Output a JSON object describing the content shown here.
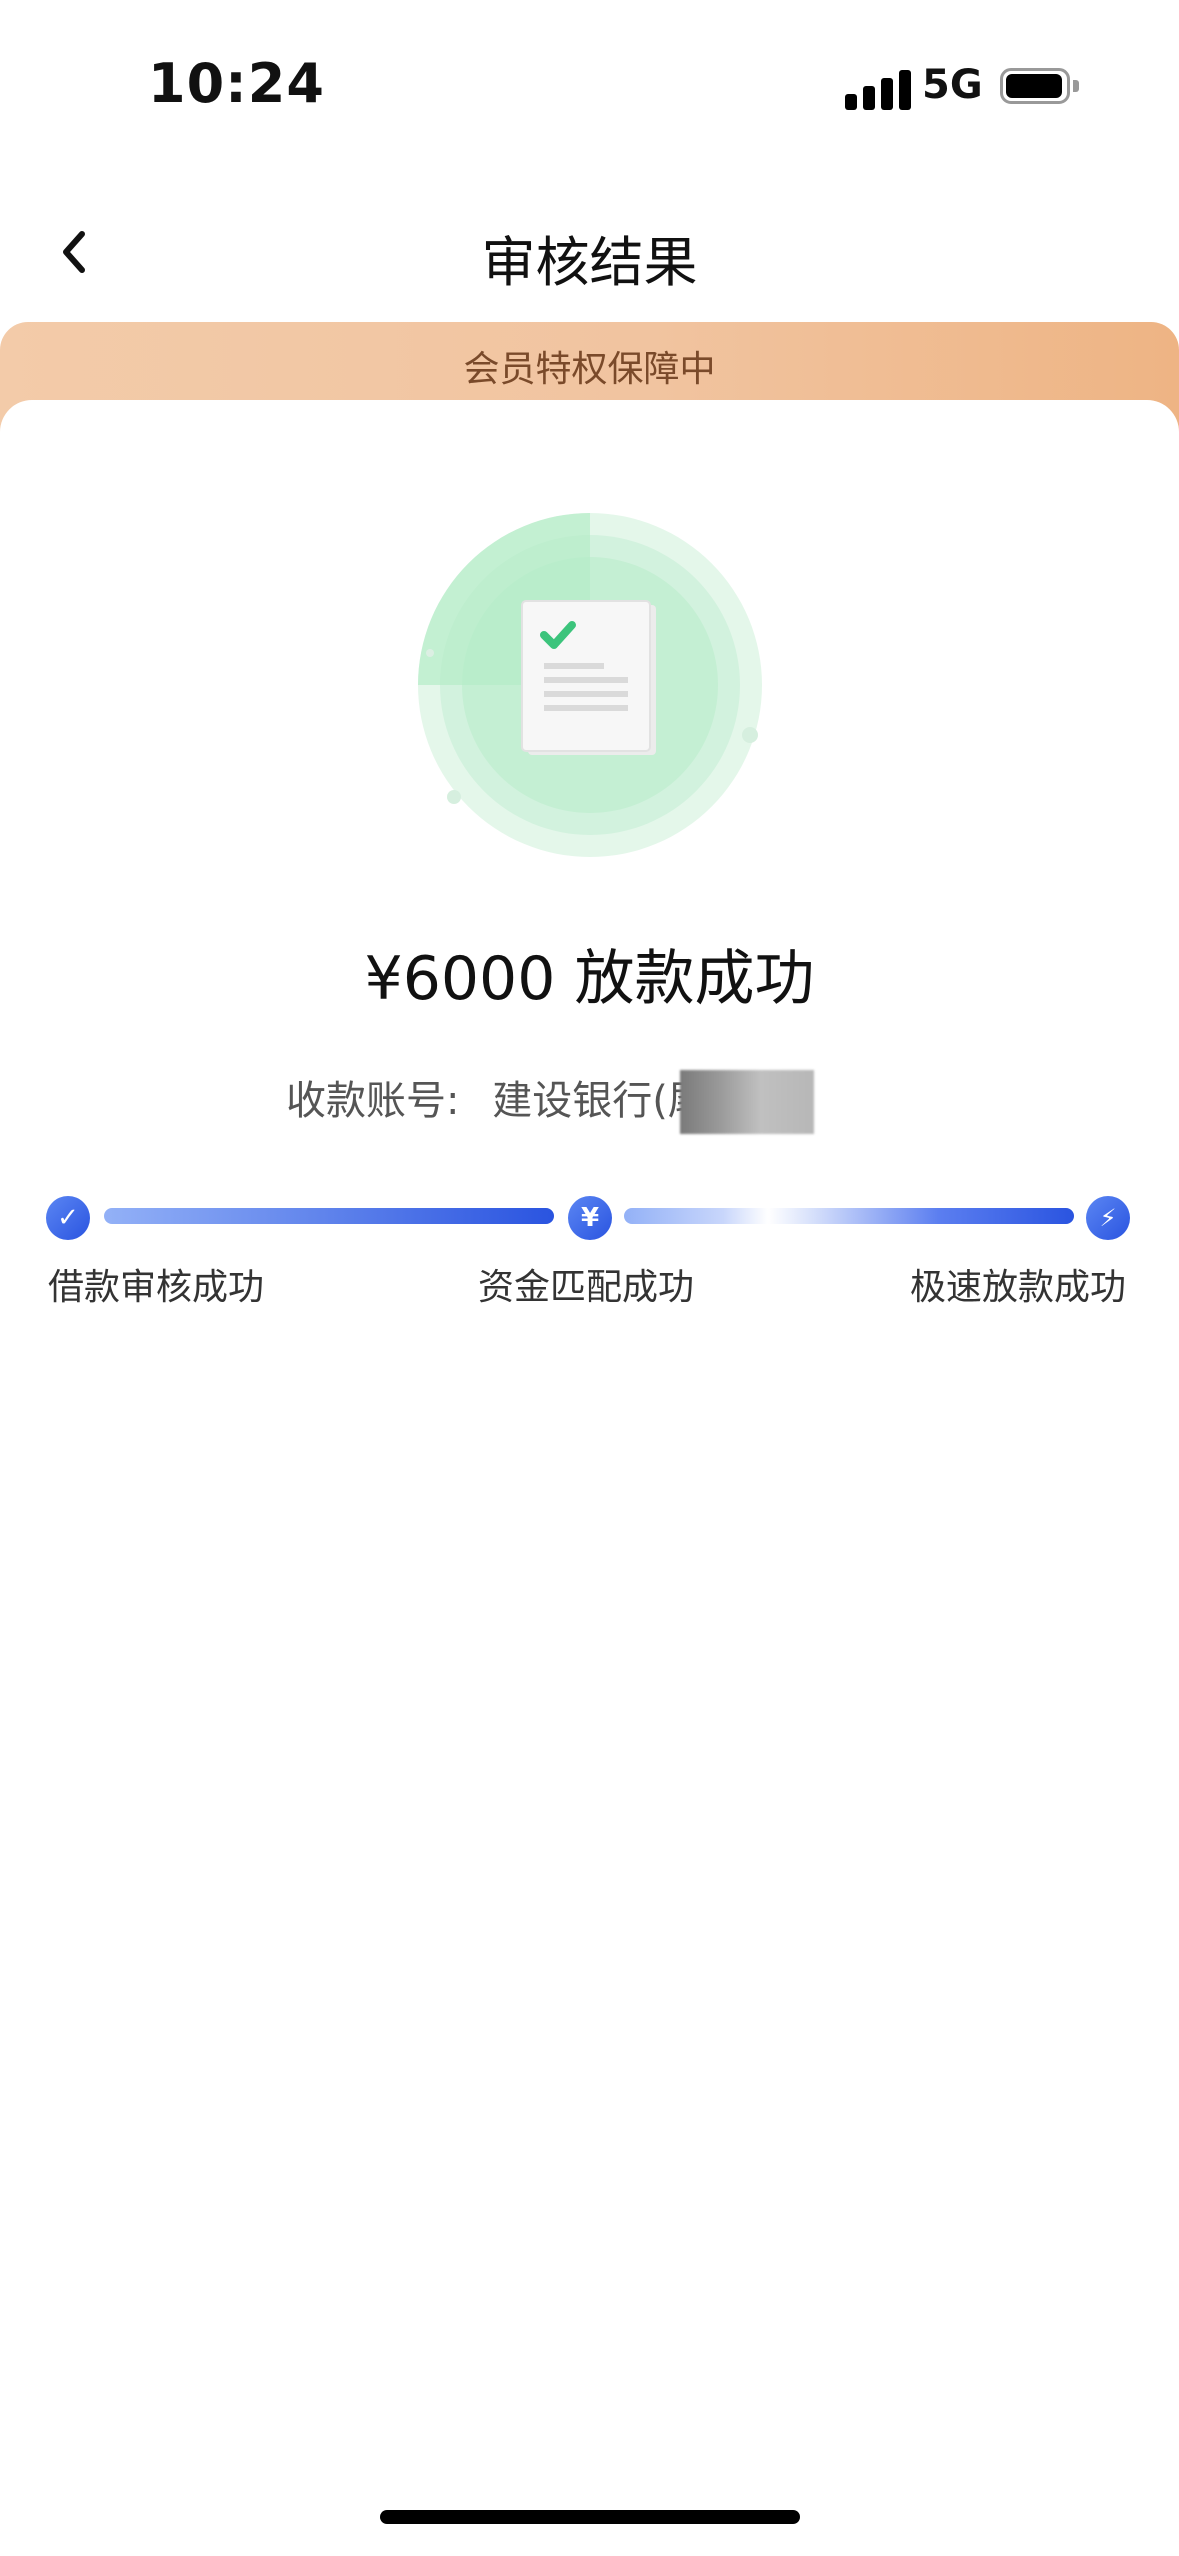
{
  "status_bar": {
    "time": "10:24",
    "network": "5G"
  },
  "nav": {
    "title": "审核结果"
  },
  "banner": {
    "text": "会员特权保障中"
  },
  "result": {
    "amount_text": "¥6000 放款成功",
    "account_label": "收款账号:",
    "account_value": "建设银行(尾号"
  },
  "progress": {
    "steps": [
      {
        "label": "借款审核成功",
        "icon": "check-icon",
        "glyph": "✓"
      },
      {
        "label": "资金匹配成功",
        "icon": "yuan-icon",
        "glyph": "¥"
      },
      {
        "label": "极速放款成功",
        "icon": "lightning-icon",
        "glyph": "⚡"
      }
    ]
  },
  "colors": {
    "accent": "#2a54e0",
    "banner": "#f1c4a0",
    "success": "#3cc47c"
  }
}
